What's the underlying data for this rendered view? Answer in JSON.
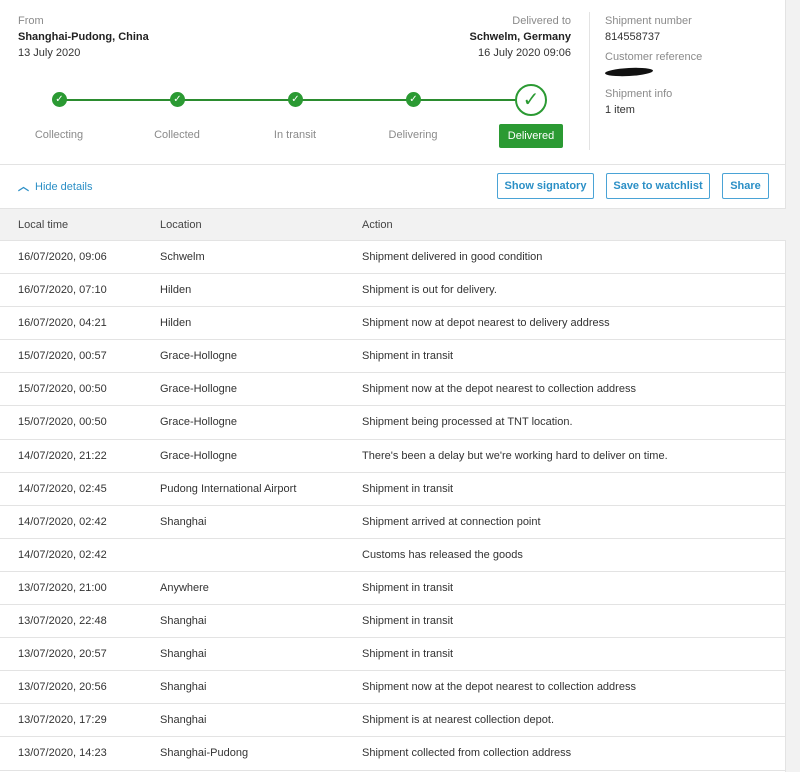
{
  "shipment": {
    "from_label": "From",
    "from_city": "Shanghai-Pudong, China",
    "from_date": "13 July 2020",
    "to_label": "Delivered to",
    "to_city": "Schwelm, Germany",
    "to_date": "16 July 2020 09:06"
  },
  "progress": {
    "steps": [
      "Collecting",
      "Collected",
      "In transit",
      "Delivering",
      "Delivered"
    ],
    "active_step": "Delivered"
  },
  "info": {
    "number_label": "Shipment number",
    "number_value": "814558737",
    "reference_label": "Customer reference",
    "shipinfo_label": "Shipment info",
    "shipinfo_value": "1 item"
  },
  "actions": {
    "hide_details": "Hide details",
    "show_signatory": "Show signatory",
    "save_watchlist": "Save to watchlist",
    "share": "Share"
  },
  "table": {
    "headers": [
      "Local time",
      "Location",
      "Action"
    ],
    "rows": [
      [
        "16/07/2020, 09:06",
        "Schwelm",
        "Shipment delivered in good condition"
      ],
      [
        "16/07/2020, 07:10",
        "Hilden",
        "Shipment is out for delivery."
      ],
      [
        "16/07/2020, 04:21",
        "Hilden",
        "Shipment now at depot nearest to delivery address"
      ],
      [
        "15/07/2020, 00:57",
        "Grace-Hollogne",
        "Shipment in transit"
      ],
      [
        "15/07/2020, 00:50",
        "Grace-Hollogne",
        "Shipment now at the depot nearest to collection address"
      ],
      [
        "15/07/2020, 00:50",
        "Grace-Hollogne",
        "Shipment being processed at TNT location."
      ],
      [
        "14/07/2020, 21:22",
        "Grace-Hollogne",
        "There's been a delay but we're working hard to deliver on time."
      ],
      [
        "14/07/2020, 02:45",
        "Pudong International Airport",
        "Shipment in transit"
      ],
      [
        "14/07/2020, 02:42",
        "Shanghai",
        "Shipment arrived at connection point"
      ],
      [
        "14/07/2020, 02:42",
        "",
        "Customs has released the goods"
      ],
      [
        "13/07/2020, 21:00",
        "Anywhere",
        "Shipment in transit"
      ],
      [
        "13/07/2020, 22:48",
        "Shanghai",
        "Shipment in transit"
      ],
      [
        "13/07/2020, 20:57",
        "Shanghai",
        "Shipment in transit"
      ],
      [
        "13/07/2020, 20:56",
        "Shanghai",
        "Shipment now at the depot nearest to collection address"
      ],
      [
        "13/07/2020, 17:29",
        "Shanghai",
        "Shipment is at nearest collection depot."
      ],
      [
        "13/07/2020, 14:23",
        "Shanghai-Pudong",
        "Shipment collected from collection address"
      ]
    ]
  },
  "colors": {
    "accent_green": "#2b9a33",
    "link_blue": "#2b8fc6"
  }
}
